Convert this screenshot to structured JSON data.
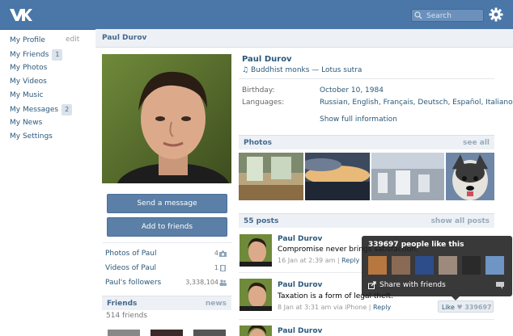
{
  "header": {
    "search_placeholder": "Search"
  },
  "sidebar": {
    "items": [
      {
        "label": "My Profile",
        "badge": ""
      },
      {
        "label": "My Friends",
        "badge": "1"
      },
      {
        "label": "My Photos",
        "badge": ""
      },
      {
        "label": "My Videos",
        "badge": ""
      },
      {
        "label": "My Music",
        "badge": ""
      },
      {
        "label": "My Messages",
        "badge": "2"
      },
      {
        "label": "My News",
        "badge": ""
      },
      {
        "label": "My Settings",
        "badge": ""
      }
    ],
    "edit_label": "edit"
  },
  "page_title": "Paul Durov",
  "profile": {
    "name": "Paul Durov",
    "status": "Buddhist monks — Lotus sutra",
    "send_message": "Send a message",
    "add_friend": "Add to friends",
    "info": [
      {
        "label": "Birthday:",
        "value": "October 10, 1984"
      },
      {
        "label": "Languages:",
        "value": "Russian, English, Français, Deutsch, Español, Italiano"
      }
    ],
    "show_full": "Show full information"
  },
  "stats": [
    {
      "label": "Photos of Paul",
      "count": "4"
    },
    {
      "label": "Videos of Paul",
      "count": "1"
    },
    {
      "label": "Paul's followers",
      "count": "3,338,104"
    }
  ],
  "friends": {
    "title": "Friends",
    "right": "news",
    "count": "514 friends"
  },
  "photos": {
    "title": "Photos",
    "right": "see all"
  },
  "posts": {
    "title": "55 posts",
    "right": "show all posts",
    "items": [
      {
        "author": "Paul Durov",
        "text": "Compromise never brings satisfaction.",
        "meta": "16 Jan at 2:39 am",
        "reply": "Reply"
      },
      {
        "author": "Paul Durov",
        "text": "Taxation is a form of legal theft.",
        "meta": "8 Jan at 3:31 am via iPhone",
        "reply": "Reply"
      },
      {
        "author": "Paul Durov",
        "text": "",
        "meta": "",
        "reply": ""
      }
    ]
  },
  "like_popup": {
    "title": "339697 people like this",
    "share": "Share with friends"
  },
  "like_button": {
    "label": "Like",
    "count": "339697"
  }
}
